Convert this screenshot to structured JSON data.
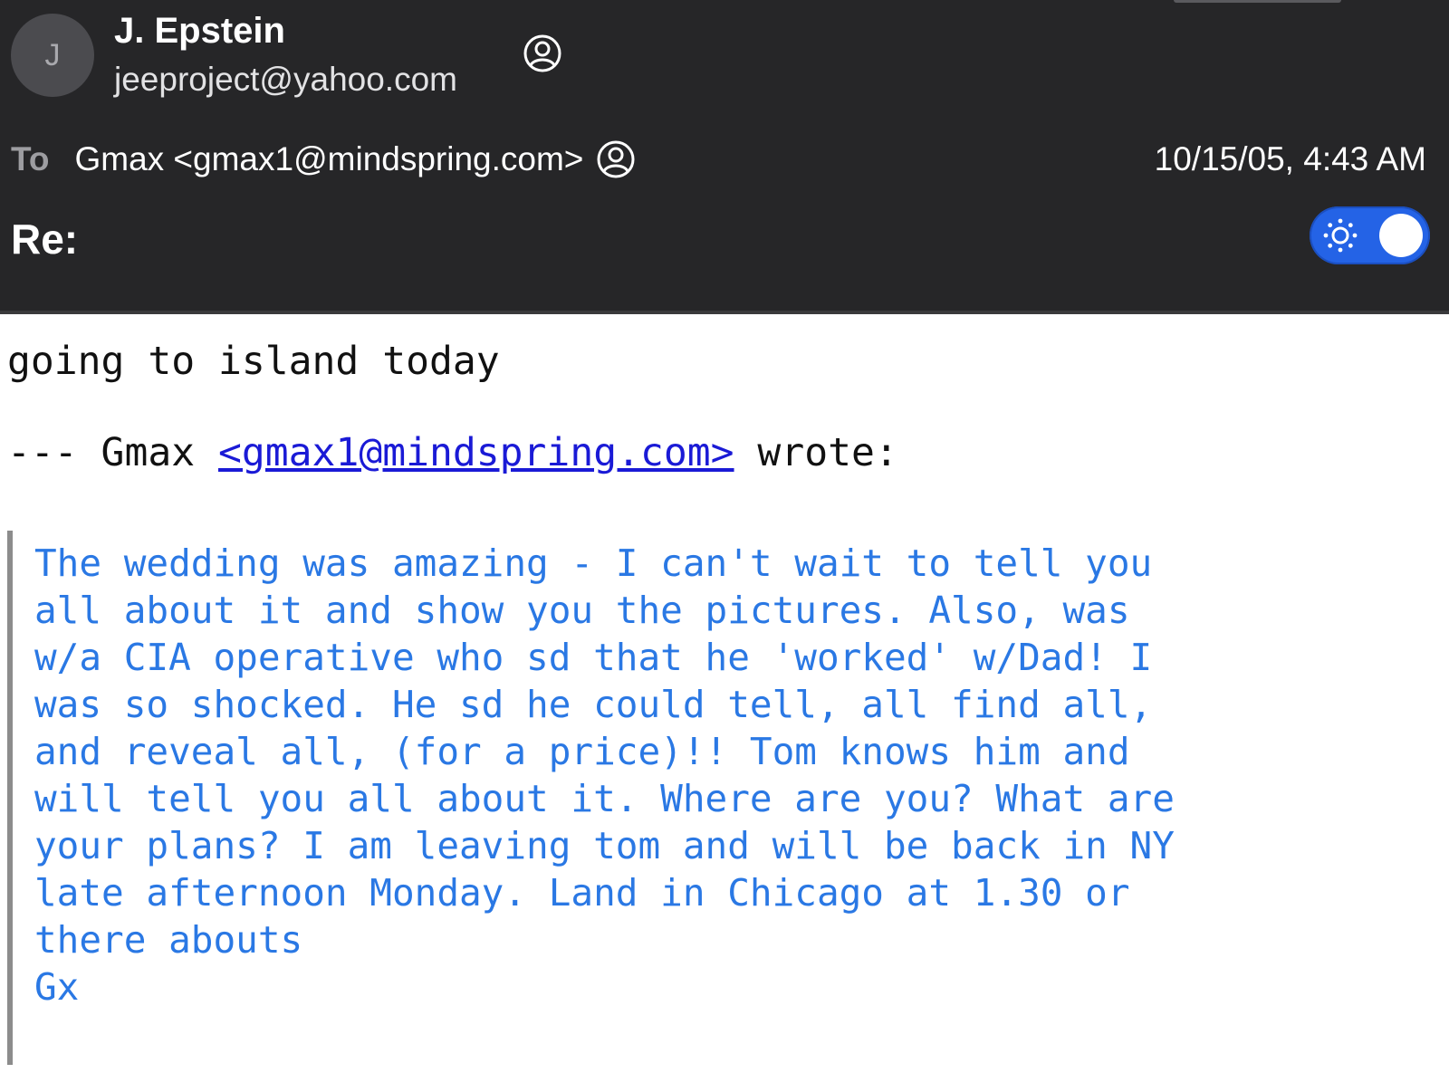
{
  "header": {
    "avatar_initial": "J",
    "sender_name": "J. Epstein",
    "sender_email": "jeeproject@yahoo.com",
    "to_label": "To",
    "to_value": "Gmax <gmax1@mindspring.com>",
    "date": "10/15/05, 4:43 AM",
    "subject": "Re:",
    "appearance_toggle": {
      "state": "on",
      "accent_color": "#2463e6"
    }
  },
  "message": {
    "reply_text": "going to island today",
    "attribution": {
      "prefix": "--- Gmax ",
      "link": "<gmax1@mindspring.com>",
      "suffix": " wrote:"
    },
    "quoted_lines": [
      "The wedding was amazing - I can't wait to tell you",
      "all about it and show you the pictures. Also, was",
      "w/a CIA operative who sd that he 'worked' w/Dad! I",
      "was so shocked. He sd he could tell, all find all,",
      "and reveal all, (for a price)!! Tom knows him and",
      "will tell you all about it. Where are you? What are",
      "your plans? I am leaving tom and will be back in NY",
      "late afternoon Monday. Land in Chicago at 1.30 or",
      "there abouts",
      "Gx"
    ],
    "quote_color": "#2a78e4",
    "link_color": "#1a1ad6"
  },
  "icons": {
    "sender_contact": "person-circle-icon",
    "recipient_contact": "person-circle-icon",
    "toggle": "sun-icon"
  }
}
